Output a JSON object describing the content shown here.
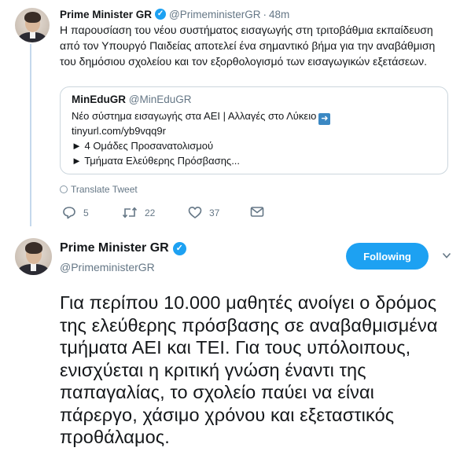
{
  "parent_tweet": {
    "name": "Prime Minister GR",
    "handle": "@PrimeministerGR",
    "time": "48m",
    "text": "Η παρουσίαση του νέου συστήματος εισαγωγής στη τριτοβάθμια εκπαίδευση από τον Υπουργό Παιδείας αποτελεί ένα σημαντικό βήμα για την αναβάθμιση του δημόσιου σχολείου και τον εξορθολογισμό των εισαγωγικών εξετάσεων.",
    "quote": {
      "name": "MinEduGR",
      "handle": "@MinEduGR",
      "line1": "Νέο σύστημα εισαγωγής στα ΑΕΙ | Αλλαγές στο Λύκειο",
      "line2": "tinyurl.com/yb9vqq9r",
      "line3": "► 4 Ομάδες Προσανατολισμού",
      "line4": "► Τμήματα Ελεύθερης Πρόσβασης..."
    },
    "translate_label": "Translate Tweet",
    "replies": "5",
    "retweets": "22",
    "likes": "37",
    "icons": [
      "reply-icon",
      "retweet-icon",
      "like-icon",
      "message-icon",
      "globe-icon",
      "verified-icon"
    ]
  },
  "main_tweet": {
    "name": "Prime Minister GR",
    "handle": "@PrimeministerGR",
    "follow_label": "Following",
    "text": "Για περίπου 10.000 μαθητές ανοίγει ο δρόμος της ελεύθερης πρόσβασης σε αναβαθμισμένα τμήματα ΑΕΙ και ΤΕΙ. Για τους υπόλοιπους, ενισχύεται η κριτική γνώση έναντι της παπαγαλίας, το σχολείο παύει να είναι πάρεργο, χάσιμο χρόνου και εξεταστικός προθάλαμος."
  },
  "colors": {
    "accent": "#1da1f2",
    "muted": "#657786",
    "thread_line": "#c4d8ec",
    "border": "#ccd6dd"
  }
}
